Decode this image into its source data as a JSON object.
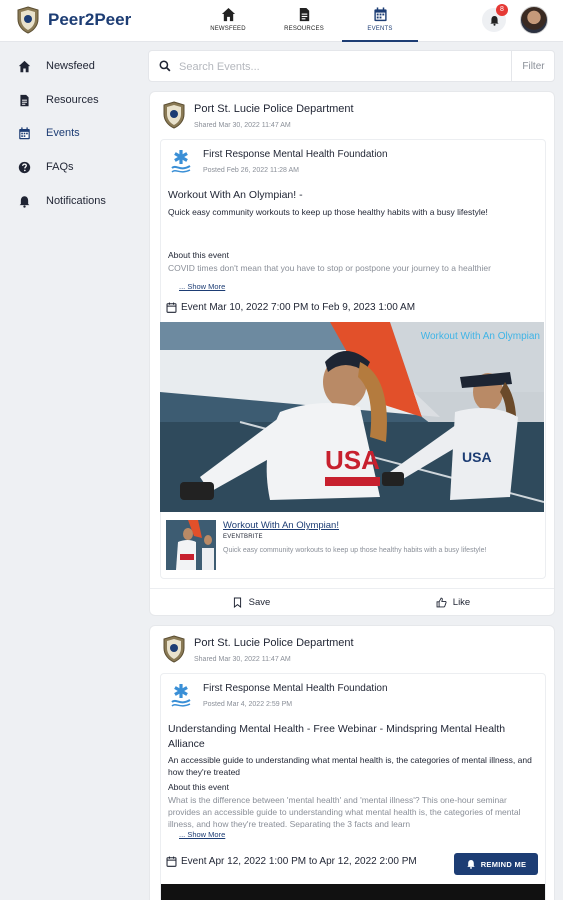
{
  "app": {
    "name": "Peer2Peer"
  },
  "topnav": [
    {
      "label": "NEWSFEED",
      "icon": "home-icon"
    },
    {
      "label": "RESOURCES",
      "icon": "document-icon"
    },
    {
      "label": "EVENTS",
      "icon": "calendar-icon",
      "active": true
    }
  ],
  "notifications": {
    "count": "8"
  },
  "sidebar": [
    {
      "label": "Newsfeed",
      "icon": "home-icon"
    },
    {
      "label": "Resources",
      "icon": "document-icon"
    },
    {
      "label": "Events",
      "icon": "calendar-icon",
      "active": true
    },
    {
      "label": "FAQs",
      "icon": "question-icon"
    },
    {
      "label": "Notifications",
      "icon": "bell-icon"
    }
  ],
  "search": {
    "placeholder": "Search Events...",
    "filter_label": "Filter"
  },
  "posts": [
    {
      "department": "Port St. Lucie Police Department",
      "shared": "Shared Mar 30, 2022 11:47 AM",
      "org": "First Response Mental Health Foundation",
      "posted": "Posted Feb 26, 2022 11:28 AM",
      "title": "Workout With An Olympian! -",
      "summary": "Quick easy community workouts to keep up those healthy habits with a busy lifestyle!",
      "about_label": "About this event",
      "about_text": "COVID times don't mean that you have to stop or postpone your journey to a healthier",
      "show_more": "... Show More",
      "event_date": "Event Mar 10, 2022 7:00 PM to Feb 9, 2023 1:00 AM",
      "image_overlay": "Workout With An Olympian",
      "link": {
        "title": "Workout With An Olympian!",
        "source": "EVENTBRITE",
        "desc": "Quick easy community workouts to keep up those healthy habits with a busy lifestyle!"
      },
      "save_label": "Save",
      "like_label": "Like"
    },
    {
      "department": "Port St. Lucie Police Department",
      "shared": "Shared Mar 30, 2022 11:47 AM",
      "org": "First Response Mental Health Foundation",
      "posted": "Posted Mar 4, 2022 2:59 PM",
      "title": "Understanding Mental Health - Free Webinar - Mindspring Mental Health Alliance",
      "summary": "An accessible guide to understanding what mental health is, the categories of mental illness, and how they're treated",
      "about_label": "About this event",
      "about_text": "What is the difference between 'mental health' and 'mental illness'? This one-hour seminar provides an accessible guide to understanding what mental health is, the categories of mental illness, and how they're treated. Separating the 3 facts and learn",
      "show_more": "... Show More",
      "event_date": "Event Apr 12, 2022 1:00 PM to Apr 12, 2022 2:00 PM",
      "remind_label": "REMIND ME"
    }
  ],
  "colors": {
    "brand": "#1d3d74",
    "badge": "#e53935",
    "overlay_text": "#3fb4e6"
  }
}
